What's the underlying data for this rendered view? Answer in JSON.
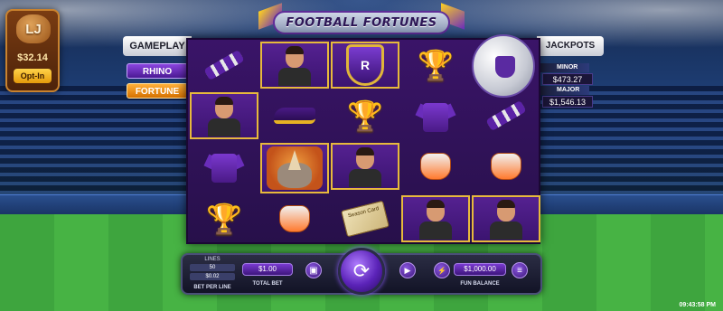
{
  "game": {
    "title": "FOOTBALL FORTUNES"
  },
  "lj": {
    "badge": "LJ",
    "amount": "$32.14",
    "opt_in_label": "Opt-In"
  },
  "side_panel": {
    "gameplay_label": "GAMEPLAY",
    "rhino_label": "RHINO",
    "fortune_label": "FORTUNE"
  },
  "jackpots": {
    "title": "JACKPOTS",
    "minor": {
      "label": "MINOR",
      "value": "$473.27"
    },
    "major": {
      "label": "MAJOR",
      "value": "$1,546.13"
    }
  },
  "reels": {
    "crest_text": "R",
    "ticket_text": "Season Card"
  },
  "controls": {
    "lines_label": "LINES",
    "lines_value": "50",
    "bet_per_line_value": "$0.02",
    "bet_per_line_label": "BET PER LINE",
    "total_bet_value": "$1.00",
    "total_bet_label": "TOTAL BET",
    "fun_balance_value": "$1,000.00",
    "fun_balance_label": "FUN BALANCE"
  },
  "clock": "09:43:58 PM",
  "colors": {
    "accent_purple": "#5b23b8",
    "gold": "#e7b93c",
    "orange": "#d57100"
  }
}
